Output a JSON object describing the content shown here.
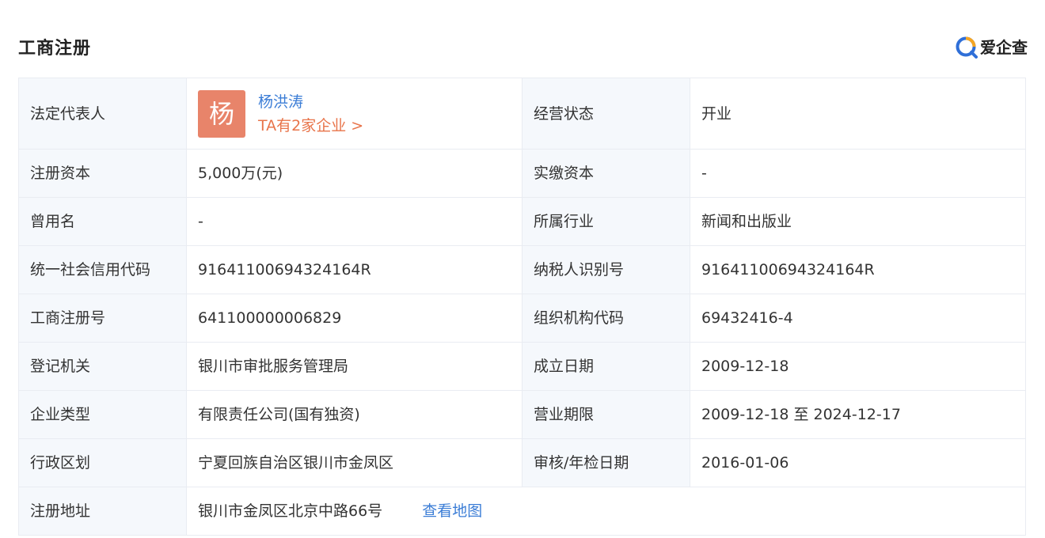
{
  "header": {
    "title": "工商注册",
    "brand_name": "爱企查",
    "brand_icon": "search-magnifier-logo-icon"
  },
  "colors": {
    "label_bg": "#f5f8fc",
    "border": "#e9ecf2",
    "link_blue": "#3b7dd6",
    "link_orange": "#e8744a",
    "avatar_bg": "#e8846a"
  },
  "legal_rep": {
    "label": "法定代表人",
    "avatar_char": "杨",
    "name": "杨洪涛",
    "companies_link": "TA有2家企业 >"
  },
  "status": {
    "label": "经营状态",
    "value": "开业"
  },
  "rows": [
    {
      "l1": "注册资本",
      "v1": "5,000万(元)",
      "l2": "实缴资本",
      "v2": "-"
    },
    {
      "l1": "曾用名",
      "v1": "-",
      "l2": "所属行业",
      "v2": "新闻和出版业"
    },
    {
      "l1": "统一社会信用代码",
      "v1": "91641100694324164R",
      "l2": "纳税人识别号",
      "v2": "91641100694324164R"
    },
    {
      "l1": "工商注册号",
      "v1": "641100000006829",
      "l2": "组织机构代码",
      "v2": "69432416-4"
    },
    {
      "l1": "登记机关",
      "v1": "银川市审批服务管理局",
      "l2": "成立日期",
      "v2": "2009-12-18"
    },
    {
      "l1": "企业类型",
      "v1": "有限责任公司(国有独资)",
      "l2": "营业期限",
      "v2": "2009-12-18 至 2024-12-17"
    },
    {
      "l1": "行政区划",
      "v1": "宁夏回族自治区银川市金凤区",
      "l2": "审核/年检日期",
      "v2": "2016-01-06"
    }
  ],
  "address": {
    "label": "注册地址",
    "value": "银川市金凤区北京中路66号",
    "map_link": "查看地图"
  }
}
